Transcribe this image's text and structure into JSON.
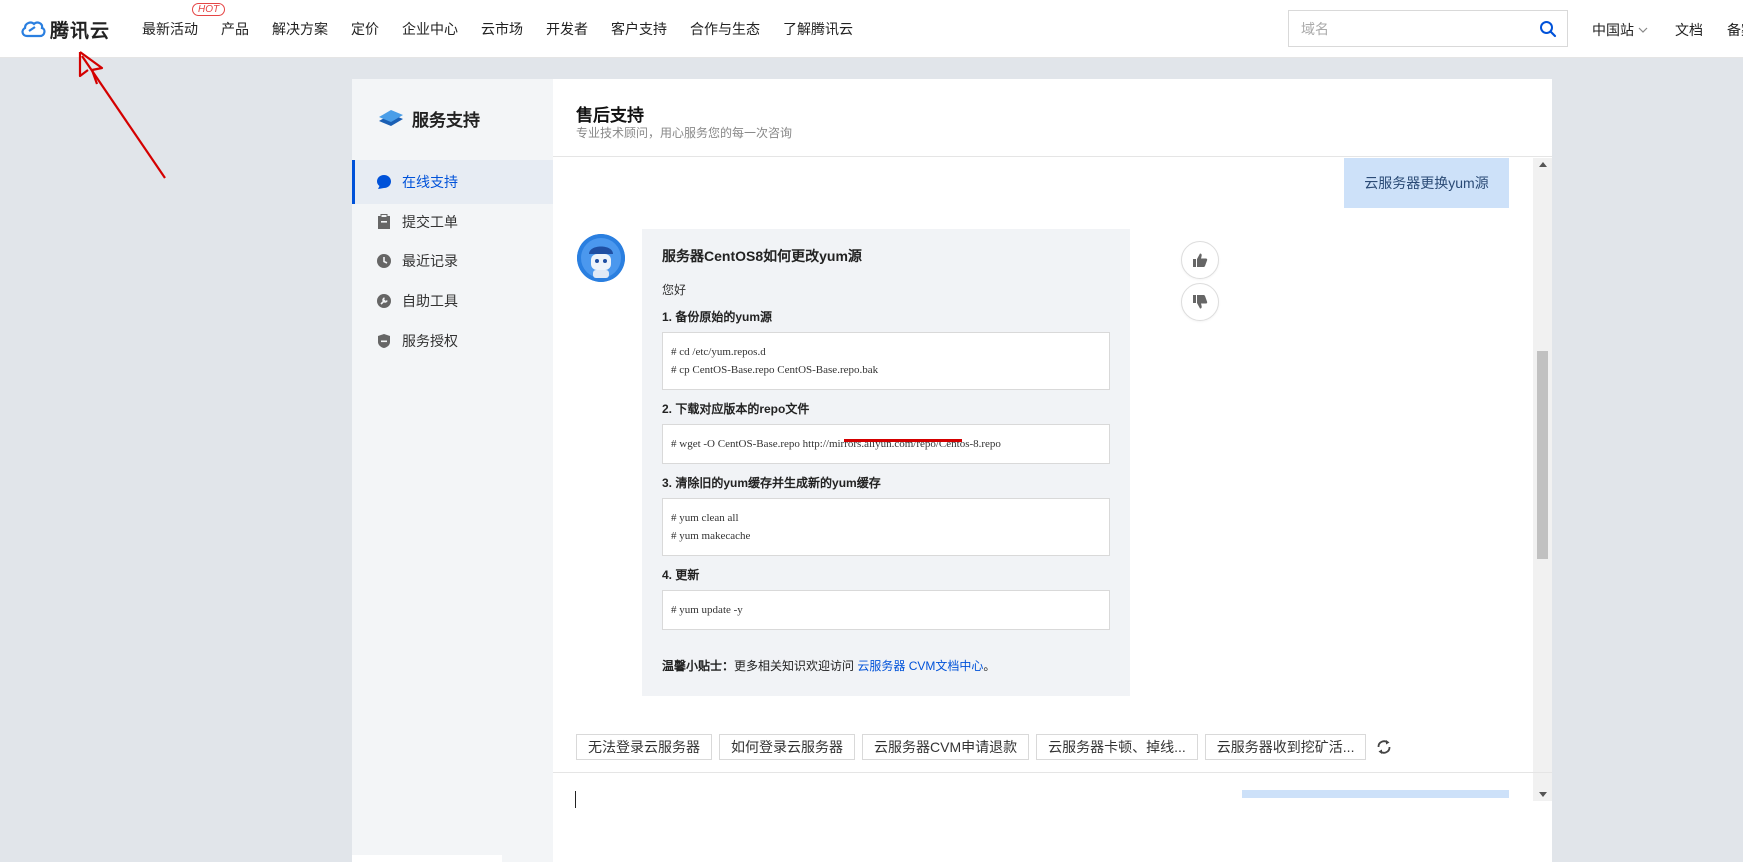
{
  "brand": {
    "name": "腾讯云"
  },
  "nav": {
    "items": [
      "最新活动",
      "产品",
      "解决方案",
      "定价",
      "企业中心",
      "云市场",
      "开发者",
      "客户支持",
      "合作与生态",
      "了解腾讯云"
    ],
    "hot_badge": "HOT"
  },
  "search": {
    "placeholder": "域名",
    "value": ""
  },
  "topright": {
    "region": "中国站",
    "doc": "文档",
    "beian": "备案"
  },
  "sidebar": {
    "title": "服务支持",
    "items": [
      {
        "label": "在线支持",
        "icon": "chat-bubble-icon",
        "active": true
      },
      {
        "label": "提交工单",
        "icon": "clipboard-icon",
        "active": false
      },
      {
        "label": "最近记录",
        "icon": "clock-icon",
        "active": false
      },
      {
        "label": "自助工具",
        "icon": "wrench-icon",
        "active": false
      },
      {
        "label": "服务授权",
        "icon": "shield-icon",
        "active": false
      }
    ]
  },
  "header": {
    "title": "售后支持",
    "subtitle": "专业技术顾问，用心服务您的每一次咨询"
  },
  "chat": {
    "user_message": "云服务器更换yum源",
    "bot": {
      "title": "服务器CentOS8如何更改yum源",
      "greeting": "您好",
      "steps": [
        {
          "heading": "1. 备份原始的yum源",
          "code": [
            "# cd /etc/yum.repos.d",
            "# cp CentOS-Base.repo CentOS-Base.repo.bak"
          ]
        },
        {
          "heading": "2. 下载对应版本的repo文件",
          "code": [
            "# wget -O CentOS-Base.repo http://mirrors.aliyun.com/repo/Centos-8.repo"
          ]
        },
        {
          "heading": "3. 清除旧的yum缓存并生成新的yum缓存",
          "code": [
            "# yum clean all",
            "# yum makecache"
          ]
        },
        {
          "heading": "4. 更新",
          "code": [
            "# yum update -y"
          ]
        }
      ],
      "tip_label": "温馨小贴士：",
      "tip_text": "更多相关知识欢迎访问 ",
      "tip_link": "云服务器 CVM文档中心",
      "tip_end": "。"
    }
  },
  "quick_questions": [
    "无法登录云服务器",
    "如何登录云服务器",
    "云服务器CVM申请退款",
    "云服务器卡顿、掉线...",
    "云服务器收到挖矿活..."
  ],
  "colors": {
    "accent": "#0052d9",
    "user_bubble": "#cde1f9",
    "annotation": "#d40000"
  }
}
